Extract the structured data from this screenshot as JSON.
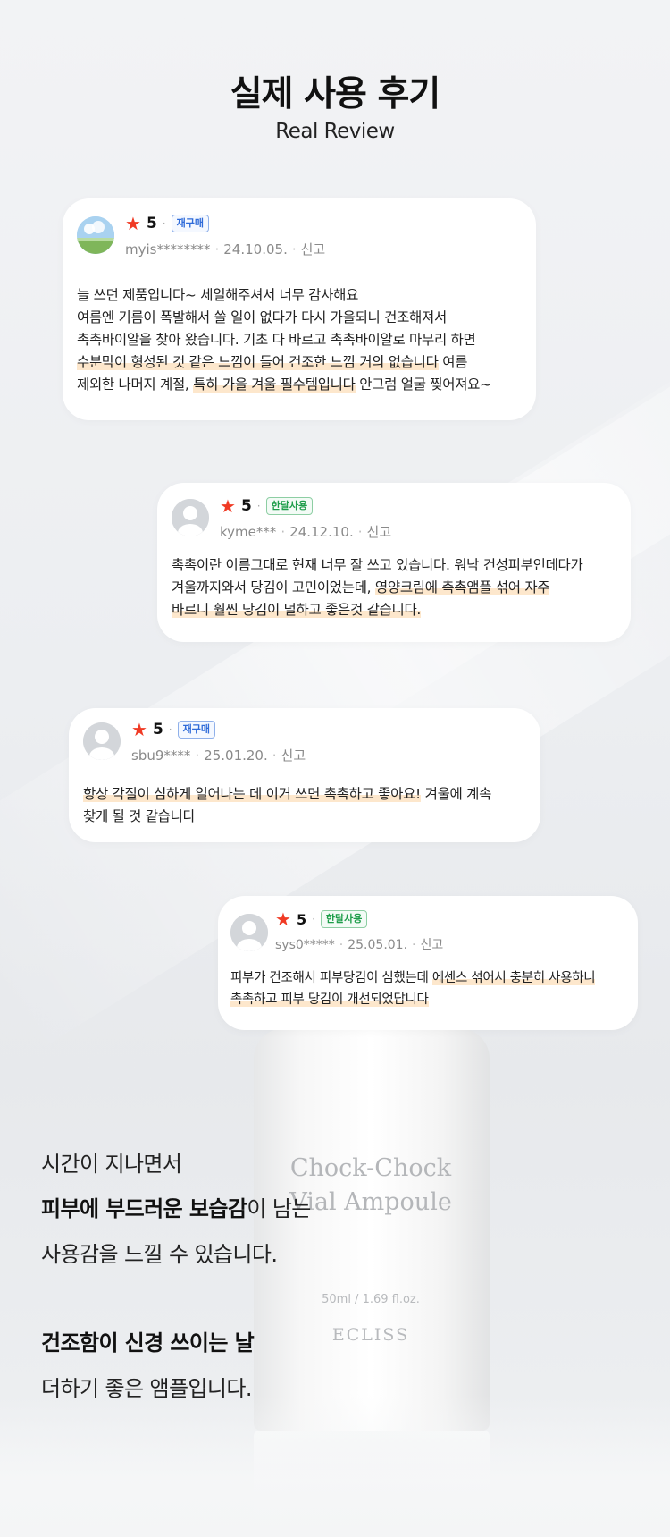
{
  "header": {
    "title": "실제 사용 후기",
    "subtitle": "Real Review"
  },
  "reviews": [
    {
      "rating": "5",
      "badge": "재구매",
      "user": "myis********",
      "date": "24.10.05.",
      "report": "신고",
      "lines": [
        {
          "plain": "늘 쓰던 제품입니다~ 세일해주셔서 너무 감사해요"
        },
        {
          "plain": "여름엔 기름이 폭발해서 쓸 일이 없다가 다시 가을되니 건조해져서"
        },
        {
          "plain": "촉촉바이알을 찾아 왔습니다. 기초 다 바르고 촉촉바이알로 마무리 하면"
        },
        {
          "hl": "수분막이 형성된 것 같은 느낌이 들어 건조한 느낌 거의 없습니다",
          "after": " 여름"
        },
        {
          "before": "제외한 나머지 계절, ",
          "hl": "특히 가을 겨울 필수템입니다",
          "after": " 안그럼 얼굴 찢어져요~"
        }
      ]
    },
    {
      "rating": "5",
      "badge": "한달사용",
      "user": "kyme***",
      "date": "24.12.10.",
      "report": "신고",
      "lines": [
        {
          "plain": "촉촉이란 이름그대로 현재 너무 잘 쓰고 있습니다. 워낙 건성피부인데다가"
        },
        {
          "before": "겨울까지와서 당김이 고민이었는데, ",
          "hl": "영양크림에 촉촉앰플 섞어 자주"
        },
        {
          "hl": "바르니 훨씬 당김이 덜하고 좋은것 같습니다."
        }
      ]
    },
    {
      "rating": "5",
      "badge": "재구매",
      "user": "sbu9****",
      "date": "25.01.20.",
      "report": "신고",
      "lines": [
        {
          "hl": "항상 각질이 심하게 일어나는 데 이거 쓰면 촉촉하고 좋아요!",
          "after": " 겨울에 계속"
        },
        {
          "plain": "찾게 될 것 같습니다"
        }
      ]
    },
    {
      "rating": "5",
      "badge": "한달사용",
      "user": "sys0*****",
      "date": "25.05.01.",
      "report": "신고",
      "lines": [
        {
          "before": "피부가 건조해서 피부당김이 심했는데 ",
          "hl": "에센스 섞어서 충분히 사용하니"
        },
        {
          "hl": "촉촉하고 피부 당김이 개선되었답니다"
        }
      ]
    }
  ],
  "product": {
    "name_line1": "Chock-Chock",
    "name_line2": "Vial Ampoule",
    "volume": "50ml / 1.69 fl.oz.",
    "brand": "ECLISS"
  },
  "copy": {
    "line1": "시간이 지나면서",
    "line2_bold": "피부에 부드러운 보습감",
    "line2_rest": "이 남는",
    "line3": "사용감을 느낄 수 있습니다.",
    "line4_bold": "건조함이 신경 쓰이는 날",
    "line5": "더하기 좋은 앰플입니다."
  },
  "colors": {
    "star": "#f03a24",
    "highlight": "#fde7cc",
    "badge_repurchase": "#2f6bd9",
    "badge_month": "#1e9d4a"
  }
}
